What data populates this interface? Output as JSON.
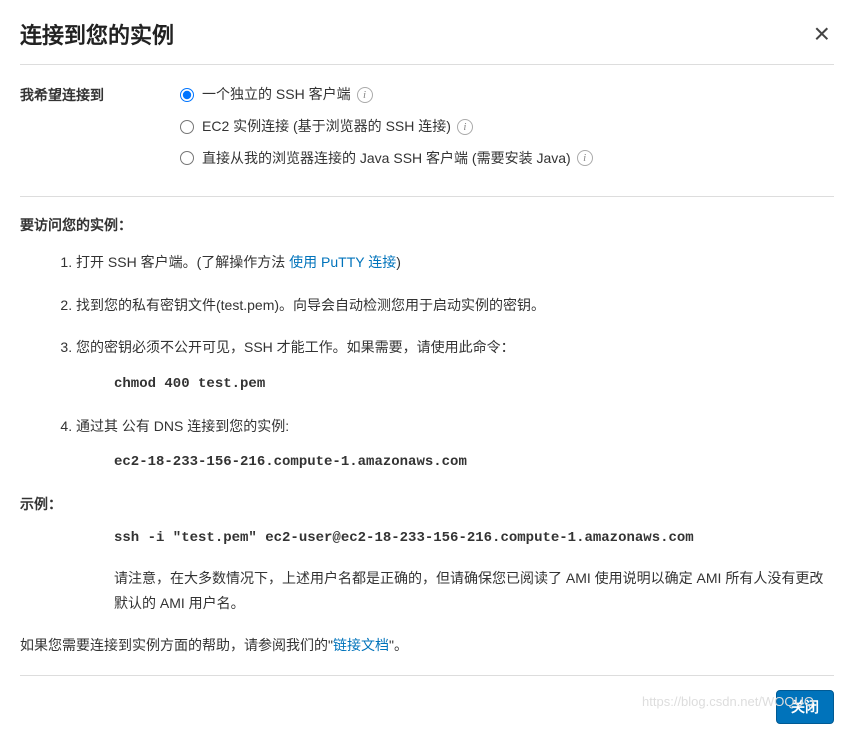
{
  "modal": {
    "title": "连接到您的实例",
    "closeX": "×"
  },
  "connect": {
    "label": "我希望连接到",
    "options": [
      {
        "label": "一个独立的 SSH 客户端",
        "checked": true
      },
      {
        "label": "EC2 实例连接 (基于浏览器的 SSH 连接)",
        "checked": false
      },
      {
        "label": "直接从我的浏览器连接的 Java SSH 客户端 (需要安装 Java)",
        "checked": false
      }
    ]
  },
  "access": {
    "title": "要访问您的实例：",
    "step1_prefix": "打开 SSH 客户端。(了解操作方法 ",
    "step1_link": "使用 PuTTY 连接",
    "step1_suffix": ")",
    "step2": "找到您的私有密钥文件(test.pem)。向导会自动检测您用于启动实例的密钥。",
    "step3": "您的密钥必须不公开可见，SSH 才能工作。如果需要，请使用此命令：",
    "step3_code": "chmod 400 test.pem",
    "step4": "通过其 公有 DNS 连接到您的实例:",
    "step4_code": "ec2-18-233-156-216.compute-1.amazonaws.com"
  },
  "example": {
    "label": "示例：",
    "code": "ssh -i \"test.pem\" ec2-user@ec2-18-233-156-216.compute-1.amazonaws.com",
    "note": "请注意，在大多数情况下，上述用户名都是正确的，但请确保您已阅读了 AMI 使用说明以确定 AMI 所有人没有更改默认的 AMI 用户名。"
  },
  "help": {
    "prefix": "如果您需要连接到实例方面的帮助，请参阅我们的\"",
    "link": "链接文档",
    "suffix": "\"。"
  },
  "footer": {
    "closeBtn": "关闭"
  },
  "watermark": "https://blog.csdn.net/WOQUQ"
}
